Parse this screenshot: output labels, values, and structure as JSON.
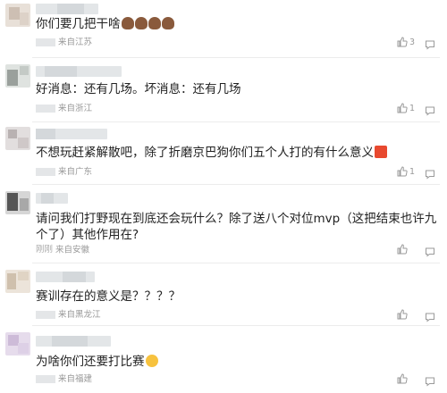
{
  "comments": [
    {
      "text": "你们要几把干啥",
      "emoji": [
        "poop",
        "poop",
        "poop",
        "poop"
      ],
      "location": "来自江苏",
      "time_label": "",
      "likes": "3"
    },
    {
      "text": "好消息：还有几场。坏消息：还有几场",
      "emoji": [],
      "location": "来自浙江",
      "time_label": "",
      "likes": "1"
    },
    {
      "text": "不想玩赶紧解散吧，除了折磨京巴狗你们五个人打的有什么意义",
      "emoji": [
        "gift"
      ],
      "location": "来自广东",
      "time_label": "",
      "likes": "1"
    },
    {
      "text": "请问我们打野现在到底还会玩什么？除了送八个对位mvp（这把结束也许九",
      "text2": "个了）其他作用在?",
      "emoji": [],
      "location": "来自安徽",
      "time_label": "刚刚",
      "likes": ""
    },
    {
      "text": "赛训存在的意义是？？？？",
      "emoji": [],
      "location": "来自黑龙江",
      "time_label": "",
      "likes": ""
    },
    {
      "text": "为啥你们还要打比赛",
      "emoji": [
        "face"
      ],
      "location": "来自福建",
      "time_label": "",
      "likes": ""
    }
  ],
  "icons": {
    "like": "thumb-up-icon",
    "reply": "comment-bubble-icon"
  },
  "colors": {
    "text": "#222222",
    "meta": "#999999",
    "divider": "#ececec"
  }
}
